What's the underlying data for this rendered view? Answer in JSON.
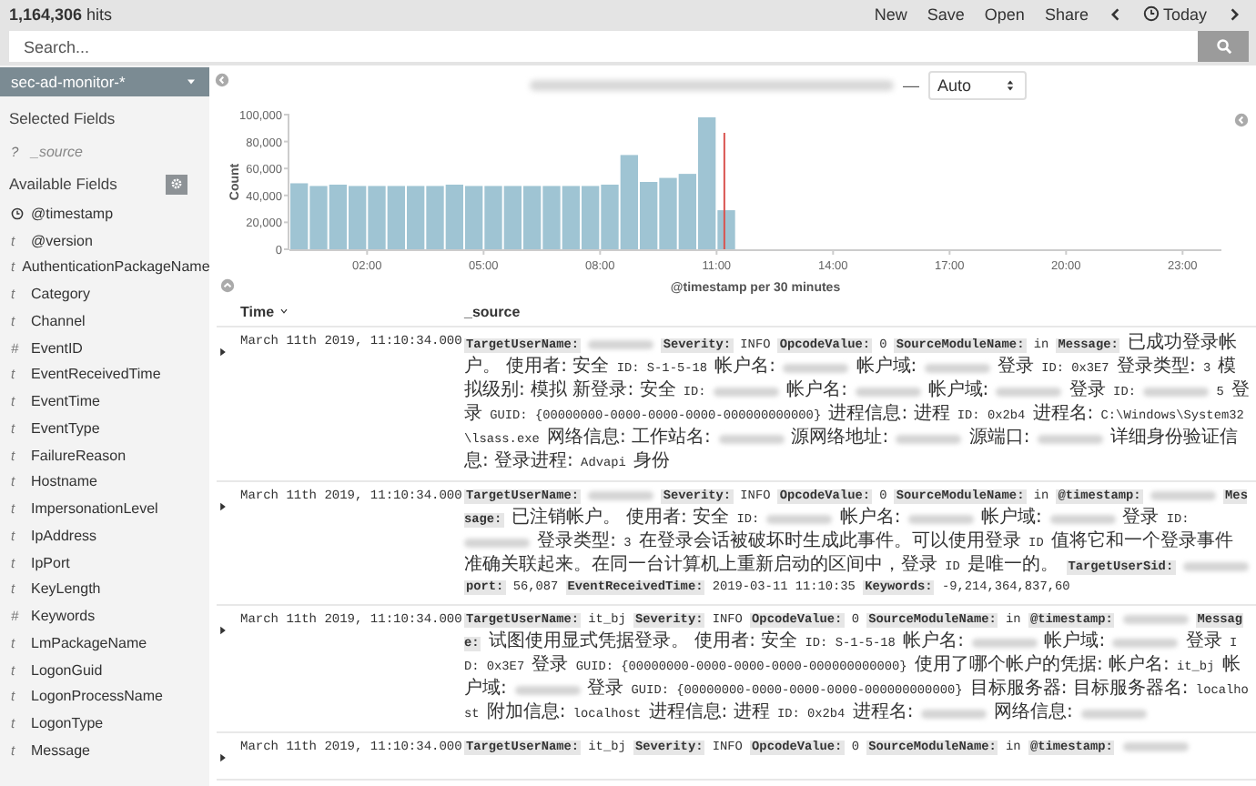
{
  "header": {
    "hits": "**1,164,306** hits",
    "menu": [
      {
        "kind": "link",
        "label": "New"
      },
      {
        "kind": "link",
        "label": "Save"
      },
      {
        "kind": "link",
        "label": "Open"
      },
      {
        "kind": "link",
        "label": "Share"
      },
      {
        "kind": "prev"
      },
      {
        "kind": "time",
        "label": "Today"
      },
      {
        "kind": "next"
      }
    ]
  },
  "search": {
    "placeholder": "Search..."
  },
  "sidebar": {
    "index_pattern": "sec-ad-monitor-*",
    "selected_title": "Selected Fields",
    "selected_fields": [
      {
        "name": "_source",
        "kind": "glyph",
        "glyph": "?"
      }
    ],
    "available_title": "Available Fields",
    "available_fields": [
      {
        "name": "@timestamp",
        "kind": "date"
      },
      {
        "name": "@version",
        "kind": "glyph",
        "glyph": "t"
      },
      {
        "name": "AuthenticationPackageName",
        "kind": "glyph",
        "glyph": "t"
      },
      {
        "name": "Category",
        "kind": "glyph",
        "glyph": "t"
      },
      {
        "name": "Channel",
        "kind": "glyph",
        "glyph": "t"
      },
      {
        "name": "EventID",
        "kind": "glyph",
        "glyph": "#"
      },
      {
        "name": "EventReceivedTime",
        "kind": "glyph",
        "glyph": "t"
      },
      {
        "name": "EventTime",
        "kind": "glyph",
        "glyph": "t"
      },
      {
        "name": "EventType",
        "kind": "glyph",
        "glyph": "t"
      },
      {
        "name": "FailureReason",
        "kind": "glyph",
        "glyph": "t"
      },
      {
        "name": "Hostname",
        "kind": "glyph",
        "glyph": "t"
      },
      {
        "name": "ImpersonationLevel",
        "kind": "glyph",
        "glyph": "t"
      },
      {
        "name": "IpAddress",
        "kind": "glyph",
        "glyph": "t"
      },
      {
        "name": "IpPort",
        "kind": "glyph",
        "glyph": "t"
      },
      {
        "name": "KeyLength",
        "kind": "glyph",
        "glyph": "t"
      },
      {
        "name": "Keywords",
        "kind": "glyph",
        "glyph": "#"
      },
      {
        "name": "LmPackageName",
        "kind": "glyph",
        "glyph": "t"
      },
      {
        "name": "LogonGuid",
        "kind": "glyph",
        "glyph": "t"
      },
      {
        "name": "LogonProcessName",
        "kind": "glyph",
        "glyph": "t"
      },
      {
        "name": "LogonType",
        "kind": "glyph",
        "glyph": "t"
      },
      {
        "name": "Message",
        "kind": "glyph",
        "glyph": "t"
      }
    ]
  },
  "timebar": {
    "range_separator": "—",
    "interval": "Auto"
  },
  "chart": {
    "chart_data": {
      "type": "bar",
      "xlabel": "@timestamp per 30 minutes",
      "ylabel": "Count",
      "x": [
        0.25,
        0.75,
        1.25,
        1.75,
        2.25,
        2.75,
        3.25,
        3.75,
        4.25,
        4.75,
        5.25,
        5.75,
        6.25,
        6.75,
        7.25,
        7.75,
        8.25,
        8.75,
        9.25,
        9.75,
        10.25,
        10.75,
        11.25
      ],
      "values": [
        49000,
        47000,
        48000,
        47000,
        47000,
        47000,
        47000,
        47000,
        48000,
        47000,
        47000,
        47000,
        47000,
        47000,
        47000,
        47000,
        48000,
        70000,
        50000,
        53000,
        56000,
        98000,
        29000
      ],
      "xlim": [
        0,
        24
      ],
      "ylim": [
        0,
        100000
      ],
      "xticks": [
        {
          "value": 2,
          "label": "02:00"
        },
        {
          "value": 5,
          "label": "05:00"
        },
        {
          "value": 8,
          "label": "08:00"
        },
        {
          "value": 11,
          "label": "11:00"
        },
        {
          "value": 14,
          "label": "14:00"
        },
        {
          "value": 17,
          "label": "17:00"
        },
        {
          "value": 20,
          "label": "20:00"
        },
        {
          "value": 23,
          "label": "23:00"
        }
      ],
      "yticks": [
        {
          "value": 0,
          "label": "0"
        },
        {
          "value": 20000,
          "label": "20,000"
        },
        {
          "value": 40000,
          "label": "40,000"
        },
        {
          "value": 60000,
          "label": "60,000"
        },
        {
          "value": 80000,
          "label": "80,000"
        },
        {
          "value": 100000,
          "label": "100,000"
        }
      ],
      "ref_lines": [
        {
          "axis": "x",
          "value": 11.2,
          "color": "#d9534f"
        }
      ]
    }
  },
  "table": {
    "columns": [
      "Time",
      "_source"
    ],
    "rows": [
      {
        "time": "March 11th 2019, 11:10:34.000",
        "source": [
          {
            "kind": "key",
            "text": "TargetUserName:"
          },
          {
            "kind": "redacted"
          },
          {
            "kind": "key",
            "text": "Severity:"
          },
          {
            "kind": "value",
            "text": "INFO"
          },
          {
            "kind": "key",
            "text": "OpcodeValue:"
          },
          {
            "kind": "value",
            "text": "0"
          },
          {
            "kind": "key",
            "text": "SourceModuleName:"
          },
          {
            "kind": "value",
            "text": "in"
          },
          {
            "kind": "key",
            "text": "Message:"
          },
          {
            "kind": "value",
            "text": "已成功登录帐户。 使用者: 安全 ID: S-1-5-18 帐户名:"
          },
          {
            "kind": "redacted"
          },
          {
            "kind": "value",
            "text": "帐户域:"
          },
          {
            "kind": "redacted"
          },
          {
            "kind": "value",
            "text": "登录 ID: 0x3E7 登录类型: 3 模拟级别: 模拟 新登录: 安全 ID:"
          },
          {
            "kind": "redacted"
          },
          {
            "kind": "value",
            "text": "帐户名:"
          },
          {
            "kind": "redacted"
          },
          {
            "kind": "value",
            "text": "帐户域:"
          },
          {
            "kind": "redacted"
          },
          {
            "kind": "value",
            "text": "登录 ID:"
          },
          {
            "kind": "redacted"
          },
          {
            "kind": "value",
            "text": "5 登录 GUID: {00000000-0000-0000-0000-000000000000} 进程信息: 进程 ID: 0x2b4 进程名: C:\\Windows\\System32\\lsass.exe 网络信息: 工作站名:"
          },
          {
            "kind": "redacted"
          },
          {
            "kind": "value",
            "text": "源网络地址:"
          },
          {
            "kind": "redacted"
          },
          {
            "kind": "value",
            "text": "源端口:"
          },
          {
            "kind": "redacted"
          },
          {
            "kind": "value",
            "text": "详细身份验证信息: 登录进程: Advapi 身份"
          }
        ]
      },
      {
        "time": "March 11th 2019, 11:10:34.000",
        "source": [
          {
            "kind": "key",
            "text": "TargetUserName:"
          },
          {
            "kind": "redacted"
          },
          {
            "kind": "key",
            "text": "Severity:"
          },
          {
            "kind": "value",
            "text": "INFO"
          },
          {
            "kind": "key",
            "text": "OpcodeValue:"
          },
          {
            "kind": "value",
            "text": "0"
          },
          {
            "kind": "key",
            "text": "SourceModuleName:"
          },
          {
            "kind": "value",
            "text": "in"
          },
          {
            "kind": "key",
            "text": "@timestamp:"
          },
          {
            "kind": "redacted"
          },
          {
            "kind": "key",
            "text": "Message:"
          },
          {
            "kind": "value",
            "text": "已注销帐户。 使用者: 安全 ID:"
          },
          {
            "kind": "redacted"
          },
          {
            "kind": "value",
            "text": "帐户名:"
          },
          {
            "kind": "redacted"
          },
          {
            "kind": "value",
            "text": "帐户域:"
          },
          {
            "kind": "redacted"
          },
          {
            "kind": "value",
            "text": "登录 ID:"
          },
          {
            "kind": "redacted"
          },
          {
            "kind": "value",
            "text": "登录类型: 3 在登录会话被破坏时生成此事件。可以使用登录 ID 值将它和一个登录事件准确关联起来。在同一台计算机上重新启动的区间中，登录 ID 是唯一的。"
          },
          {
            "kind": "key",
            "text": "TargetUserSid:"
          },
          {
            "kind": "redacted"
          },
          {
            "kind": "key",
            "text": "port:"
          },
          {
            "kind": "value",
            "text": "56,087"
          },
          {
            "kind": "key",
            "text": "EventReceivedTime:"
          },
          {
            "kind": "value",
            "text": "2019-03-11 11:10:35"
          },
          {
            "kind": "key",
            "text": "Keywords:"
          },
          {
            "kind": "value",
            "text": "-9,214,364,837,60"
          }
        ]
      },
      {
        "time": "March 11th 2019, 11:10:34.000",
        "source": [
          {
            "kind": "key",
            "text": "TargetUserName:"
          },
          {
            "kind": "value",
            "text": "it_bj"
          },
          {
            "kind": "key",
            "text": "Severity:"
          },
          {
            "kind": "value",
            "text": "INFO"
          },
          {
            "kind": "key",
            "text": "OpcodeValue:"
          },
          {
            "kind": "value",
            "text": "0"
          },
          {
            "kind": "key",
            "text": "SourceModuleName:"
          },
          {
            "kind": "value",
            "text": "in"
          },
          {
            "kind": "key",
            "text": "@timestamp:"
          },
          {
            "kind": "redacted"
          },
          {
            "kind": "key",
            "text": "Message:"
          },
          {
            "kind": "value",
            "text": "试图使用显式凭据登录。 使用者: 安全 ID: S-1-5-18 帐户名:"
          },
          {
            "kind": "redacted"
          },
          {
            "kind": "value",
            "text": "帐户域:"
          },
          {
            "kind": "redacted"
          },
          {
            "kind": "value",
            "text": "登录 ID: 0x3E7 登录 GUID: {00000000-0000-0000-0000-000000000000} 使用了哪个帐户的凭据: 帐户名: it_bj 帐户域:"
          },
          {
            "kind": "redacted"
          },
          {
            "kind": "value",
            "text": "登录 GUID: {00000000-0000-0000-0000-000000000000} 目标服务器: 目标服务器名: localhost 附加信息: localhost 进程信息: 进程 ID: 0x2b4 进程名:"
          },
          {
            "kind": "redacted"
          },
          {
            "kind": "value",
            "text": "网络信息:"
          },
          {
            "kind": "redacted"
          }
        ]
      },
      {
        "time": "March 11th 2019, 11:10:34.000",
        "source": [
          {
            "kind": "key",
            "text": "TargetUserName:"
          },
          {
            "kind": "value",
            "text": "it_bj"
          },
          {
            "kind": "key",
            "text": "Severity:"
          },
          {
            "kind": "value",
            "text": "INFO"
          },
          {
            "kind": "key",
            "text": "OpcodeValue:"
          },
          {
            "kind": "value",
            "text": "0"
          },
          {
            "kind": "key",
            "text": "SourceModuleName:"
          },
          {
            "kind": "value",
            "text": "in"
          },
          {
            "kind": "key",
            "text": "@timestamp:"
          },
          {
            "kind": "redacted"
          }
        ]
      }
    ]
  }
}
